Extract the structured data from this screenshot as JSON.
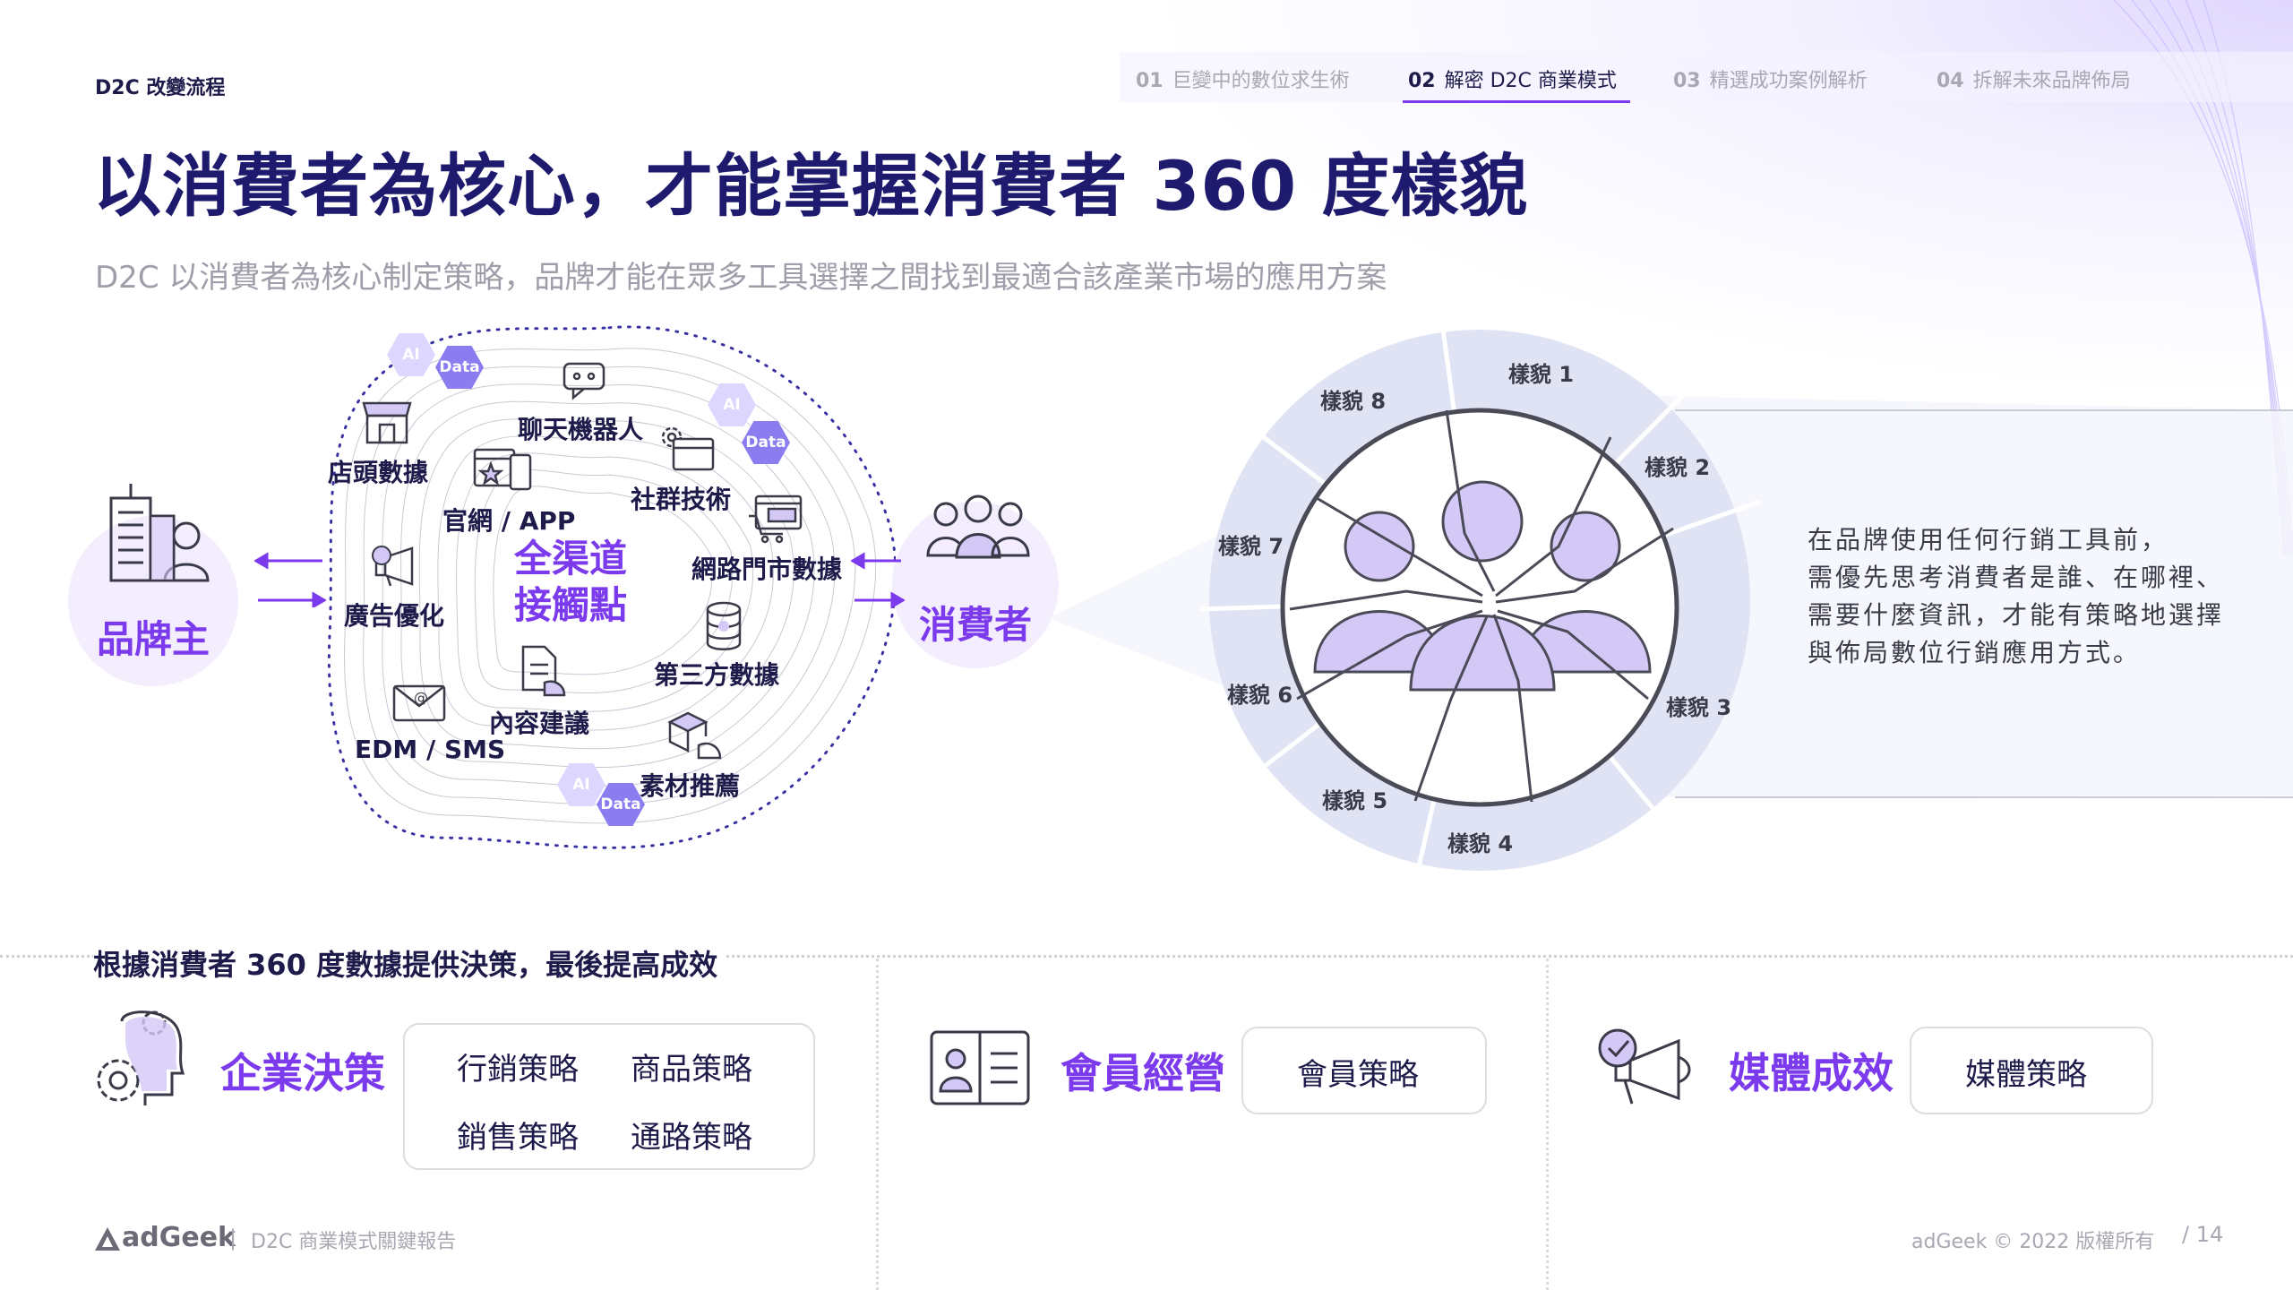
{
  "header": {
    "section_tag": "D2C 改變流程",
    "nav": [
      {
        "num": "01",
        "label": "巨變中的數位求生術"
      },
      {
        "num": "02",
        "label": "解密 D2C 商業模式"
      },
      {
        "num": "03",
        "label": "精選成功案例解析"
      },
      {
        "num": "04",
        "label": "拆解未來品牌佈局"
      }
    ]
  },
  "title": "以消費者為核心，才能掌握消費者 360 度樣貌",
  "subtitle": "D2C 以消費者為核心制定策略，品牌才能在眾多工具選擇之間找到最適合該產業市場的應用方案",
  "diagram": {
    "brand_owner": "品牌主",
    "center": [
      "全渠道",
      "接觸點"
    ],
    "consumer": "消費者",
    "channels": {
      "store": "店頭數據",
      "chatbot": "聊天機器人",
      "website": "官網 / APP",
      "social": "社群技術",
      "ads": "廣告優化",
      "ecommerce": "網路門市數據",
      "third_party": "第三方數據",
      "content": "內容建議",
      "edm": "EDM / SMS",
      "assets": "素材推薦"
    },
    "badges": {
      "ai": "AI",
      "data": "Data"
    }
  },
  "wheel": {
    "facets": [
      "樣貌 1",
      "樣貌 2",
      "樣貌 3",
      "樣貌 4",
      "樣貌 5",
      "樣貌 6",
      "樣貌 7",
      "樣貌 8"
    ],
    "description": [
      "在品牌使用任何行銷工具前，",
      "需優先思考消費者是誰、在哪裡、",
      "需要什麼資訊，才能有策略地選擇",
      "與佈局數位行銷應用方式。"
    ]
  },
  "bottom": {
    "heading": "根據消費者 360 度數據提供決策，最後提高成效",
    "groups": [
      {
        "title": "企業決策",
        "items": [
          "行銷策略",
          "商品策略",
          "銷售策略",
          "通路策略"
        ]
      },
      {
        "title": "會員經營",
        "items": [
          "會員策略"
        ]
      },
      {
        "title": "媒體成效",
        "items": [
          "媒體策略"
        ]
      }
    ]
  },
  "footer": {
    "logo": "adGeek",
    "separator": "|",
    "report": "D2C 商業模式關鍵報告",
    "copyright": "adGeek © 2022 版權所有",
    "page": "/ 14"
  },
  "colors": {
    "accent": "#7c3aed",
    "title": "#1e1b6e",
    "muted": "#a8a8b3",
    "wheel_ring": "#dfe3f4",
    "figure_fill": "#d4c8f7"
  },
  "icons": [
    "building-person-icon",
    "people-group-icon",
    "store-icon",
    "chatbot-icon",
    "browser-devices-icon",
    "social-gear-icon",
    "megaphone-icon",
    "cart-browser-icon",
    "database-icon",
    "document-hand-icon",
    "envelope-icon",
    "boxes-hand-icon",
    "gear-head-icon",
    "id-card-icon",
    "megaphone-check-icon",
    "adgeek-logo-icon"
  ]
}
